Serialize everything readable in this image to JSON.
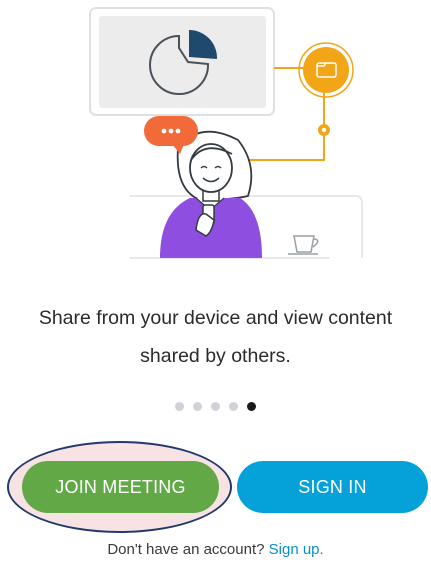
{
  "onboarding": {
    "message_line1": "Share from your device and view content",
    "message_line2": "shared by others.",
    "pager": {
      "total": 5,
      "active_index": 4
    }
  },
  "actions": {
    "join_label": "JOIN MEETING",
    "signin_label": "SIGN IN"
  },
  "footer": {
    "prompt": "Don't have an account?",
    "link": "Sign up."
  },
  "colors": {
    "join": "#62a847",
    "signin": "#04a2d9",
    "link": "#0a8ec4",
    "accent_orange": "#f2a516",
    "chat_bubble": "#f26a3a",
    "shirt": "#8e4ee0"
  },
  "illustration": {
    "icons": [
      "pie-chart-icon",
      "folder-icon",
      "chat-bubble-icon",
      "coffee-cup-icon"
    ]
  }
}
